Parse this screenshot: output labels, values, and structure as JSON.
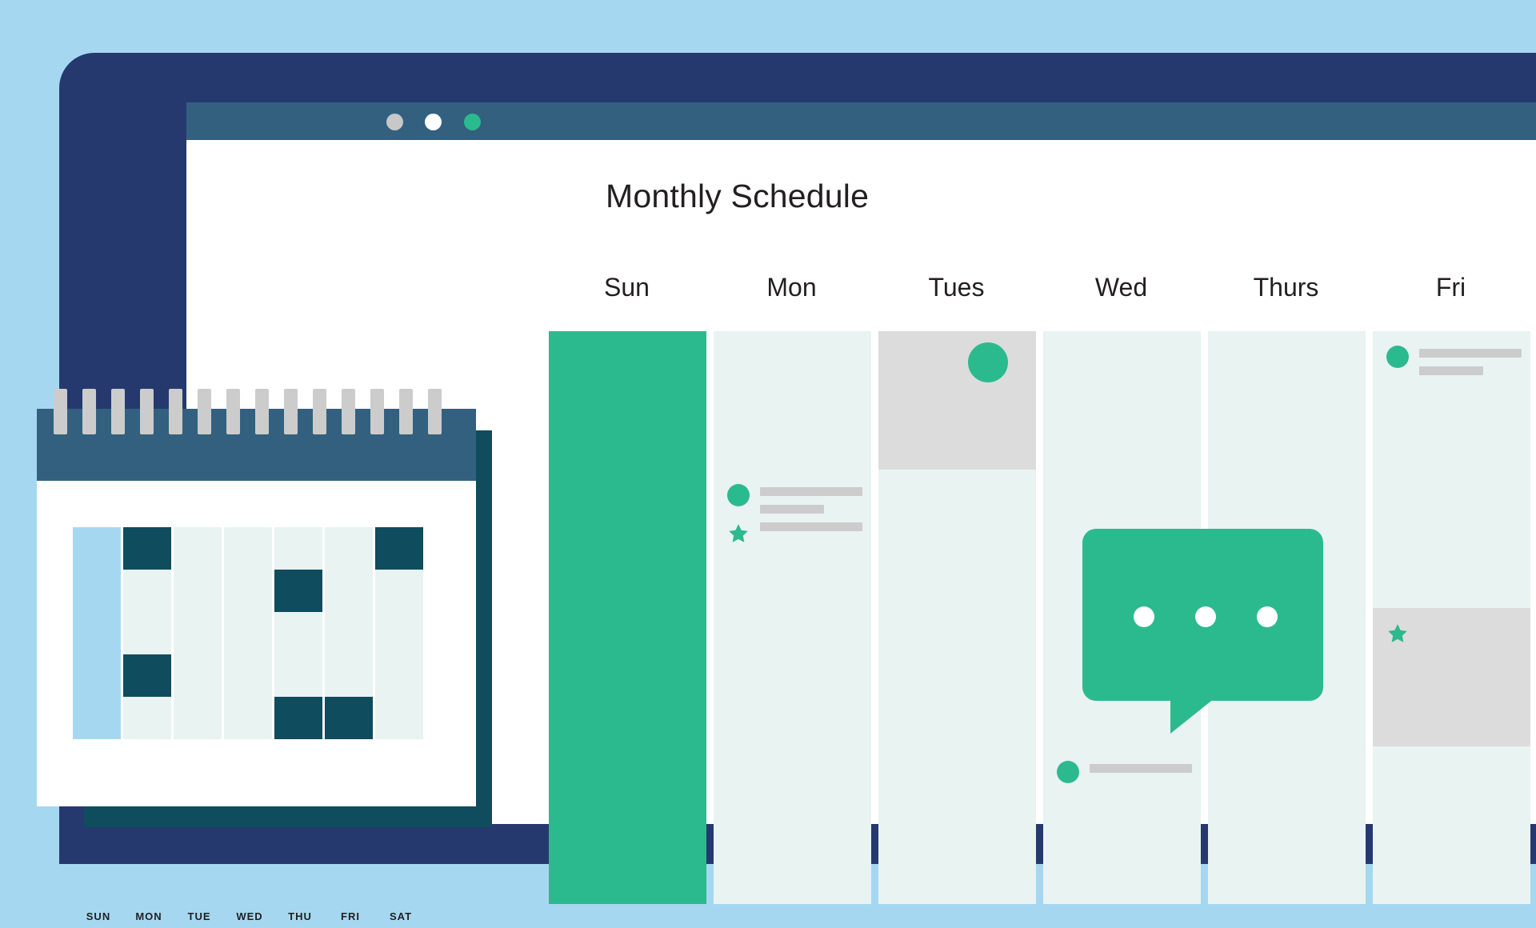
{
  "window": {
    "titlebar_dots": [
      {
        "name": "close-dot",
        "color": "#c8c8c8"
      },
      {
        "name": "minimize-dot",
        "color": "#ffffff"
      },
      {
        "name": "maximize-dot",
        "color": "#2bba8e"
      }
    ]
  },
  "page": {
    "title": "Monthly Schedule"
  },
  "colors": {
    "background": "#a5d8f0",
    "navy_panel": "#25396f",
    "titlebar": "#33607f",
    "accent_green": "#2bba8e",
    "cell_empty": "#e9f3f1",
    "cell_muted": "#dcdcdc",
    "bar_gray": "#cccccc",
    "mini_highlight": "#0e4c5e",
    "mini_sunday": "#a5d8f0",
    "text": "#231f20"
  },
  "calendar": {
    "weekdays": [
      "Sun",
      "Mon",
      "Tues",
      "Wed",
      "Thurs",
      "Fri"
    ],
    "rows": [
      {
        "row_index": 0,
        "cells": [
          {
            "day": "Sun",
            "state": "highlight",
            "events": []
          },
          {
            "day": "Mon",
            "state": "empty",
            "events": []
          },
          {
            "day": "Tues",
            "state": "muted",
            "events": [
              {
                "type": "circle-large"
              }
            ]
          },
          {
            "day": "Wed",
            "state": "empty",
            "events": []
          },
          {
            "day": "Thurs",
            "state": "empty",
            "events": []
          },
          {
            "day": "Fri",
            "state": "empty",
            "events": [
              {
                "type": "circle-small"
              },
              {
                "type": "bar"
              },
              {
                "type": "bar"
              }
            ]
          }
        ]
      },
      {
        "row_index": 1,
        "cells": [
          {
            "day": "Sun",
            "state": "highlight",
            "events": []
          },
          {
            "day": "Mon",
            "state": "empty",
            "events": [
              {
                "type": "circle-small"
              },
              {
                "type": "bar"
              },
              {
                "type": "bar"
              },
              {
                "type": "star"
              },
              {
                "type": "bar"
              }
            ]
          },
          {
            "day": "Tues",
            "state": "empty",
            "events": []
          },
          {
            "day": "Wed",
            "state": "empty",
            "events": []
          },
          {
            "day": "Thurs",
            "state": "empty",
            "events": []
          },
          {
            "day": "Fri",
            "state": "empty",
            "events": []
          }
        ]
      },
      {
        "row_index": 2,
        "cells": [
          {
            "day": "Sun",
            "state": "highlight",
            "events": []
          },
          {
            "day": "Mon",
            "state": "empty",
            "events": []
          },
          {
            "day": "Tues",
            "state": "empty",
            "events": []
          },
          {
            "day": "Wed",
            "state": "empty",
            "events": []
          },
          {
            "day": "Thurs",
            "state": "empty",
            "events": []
          },
          {
            "day": "Fri",
            "state": "muted",
            "events": [
              {
                "type": "star"
              }
            ]
          }
        ]
      },
      {
        "row_index": 3,
        "cells": [
          {
            "day": "Sun",
            "state": "highlight",
            "events": []
          },
          {
            "day": "Mon",
            "state": "empty",
            "events": []
          },
          {
            "day": "Tues",
            "state": "empty",
            "events": []
          },
          {
            "day": "Wed",
            "state": "empty",
            "events": [
              {
                "type": "circle-small"
              },
              {
                "type": "bar"
              }
            ]
          },
          {
            "day": "Thurs",
            "state": "empty",
            "events": []
          },
          {
            "day": "Fri",
            "state": "empty",
            "events": []
          }
        ]
      }
    ]
  },
  "speech_bubble": {
    "name": "typing-indicator-bubble",
    "dot_count": 3,
    "color": "#2bba8e"
  },
  "desk_calendar": {
    "weekdays": [
      "SUN",
      "MON",
      "TUE",
      "WED",
      "THU",
      "FRI",
      "SAT"
    ],
    "rows": [
      [
        "sunday",
        "highlight",
        "empty",
        "empty",
        "empty",
        "empty",
        "highlight"
      ],
      [
        "sunday",
        "empty",
        "empty",
        "empty",
        "highlight",
        "empty",
        "empty"
      ],
      [
        "sunday",
        "empty",
        "empty",
        "empty",
        "empty",
        "empty",
        "empty"
      ],
      [
        "sunday",
        "highlight",
        "empty",
        "empty",
        "empty",
        "empty",
        "empty"
      ],
      [
        "sunday",
        "empty",
        "empty",
        "empty",
        "highlight",
        "highlight",
        "empty"
      ]
    ],
    "ring_count": 14
  }
}
